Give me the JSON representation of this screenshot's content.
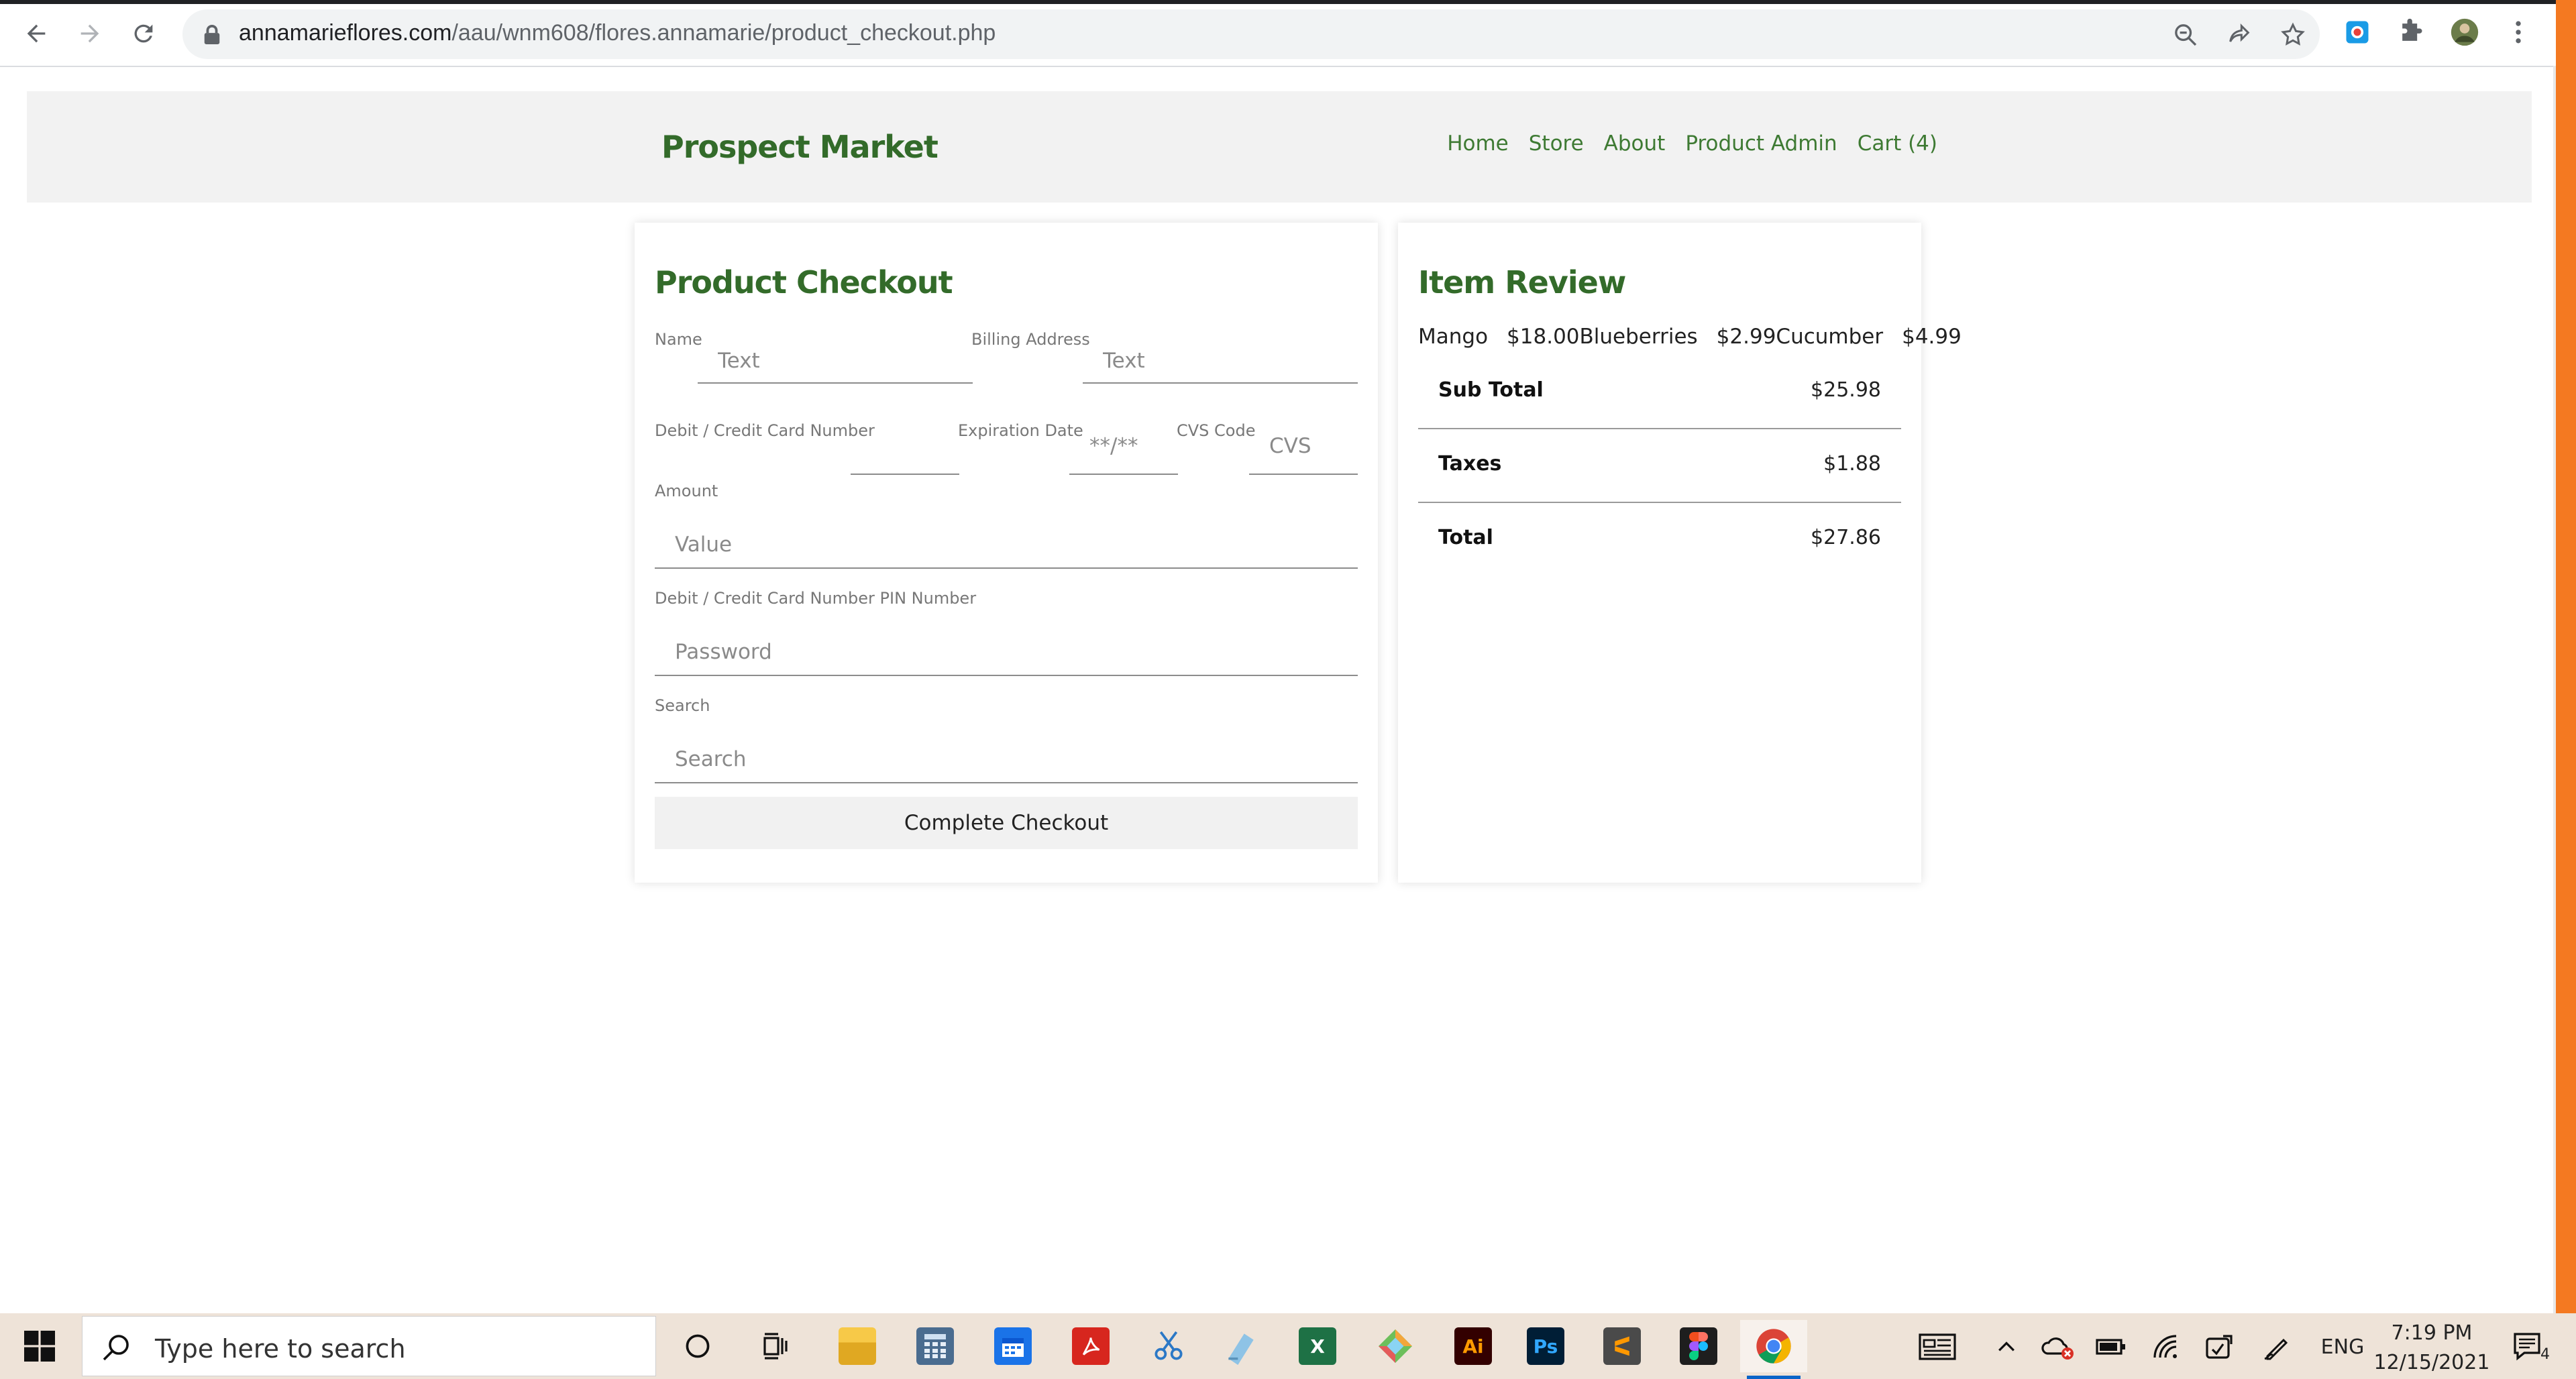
{
  "browser": {
    "url_host": "annamarieflores.com",
    "url_path": "/aau/wnm608/flores.annamarie/product_checkout.php"
  },
  "site": {
    "brand": "Prospect Market",
    "nav": [
      "Home",
      "Store",
      "About",
      "Product Admin",
      "Cart (4)"
    ]
  },
  "checkout": {
    "title": "Product Checkout",
    "name_label": "Name",
    "name_placeholder": "Text",
    "billing_label": "Billing Address",
    "billing_placeholder": "Text",
    "card_label": "Debit / Credit Card Number",
    "card_placeholder": "",
    "exp_label": "Expiration Date",
    "exp_placeholder": "**/**",
    "cvs_label": "CVS Code",
    "cvs_placeholder": "CVS",
    "amount_label": "Amount",
    "amount_placeholder": "Value",
    "pin_label": "Debit / Credit Card Number PIN Number",
    "pin_placeholder": "Password",
    "search_label": "Search",
    "search_placeholder": "Search",
    "submit_label": "Complete Checkout"
  },
  "review": {
    "title": "Item Review",
    "items": [
      {
        "name": "Mango",
        "price": "$18.00"
      },
      {
        "name": "Blueberries",
        "price": "$2.99"
      },
      {
        "name": "Cucumber",
        "price": "$4.99"
      }
    ],
    "subtotal_label": "Sub Total",
    "subtotal_value": "$25.98",
    "taxes_label": "Taxes",
    "taxes_value": "$1.88",
    "total_label": "Total",
    "total_value": "$27.86"
  },
  "taskbar": {
    "search_placeholder": "Type here to search",
    "apps": [
      "cortana-icon",
      "task-view-icon",
      "file-explorer-icon",
      "calculator-icon",
      "calendar-icon",
      "acrobat-icon",
      "snip-icon",
      "notepad-icon",
      "excel-icon",
      "git-icon",
      "illustrator-icon",
      "photoshop-icon",
      "sublime-icon",
      "figma-icon",
      "chrome-icon"
    ],
    "illustrator_text": "Ai",
    "photoshop_text": "Ps",
    "excel_text": "X",
    "language": "ENG",
    "time": "7:19 PM",
    "date": "12/15/2021",
    "notification_count": "4"
  },
  "colors": {
    "brand_green": "#336b2a",
    "nav_green": "#3e7a33",
    "taskbar": "#eee3d8",
    "accent_orange": "#f47921"
  }
}
